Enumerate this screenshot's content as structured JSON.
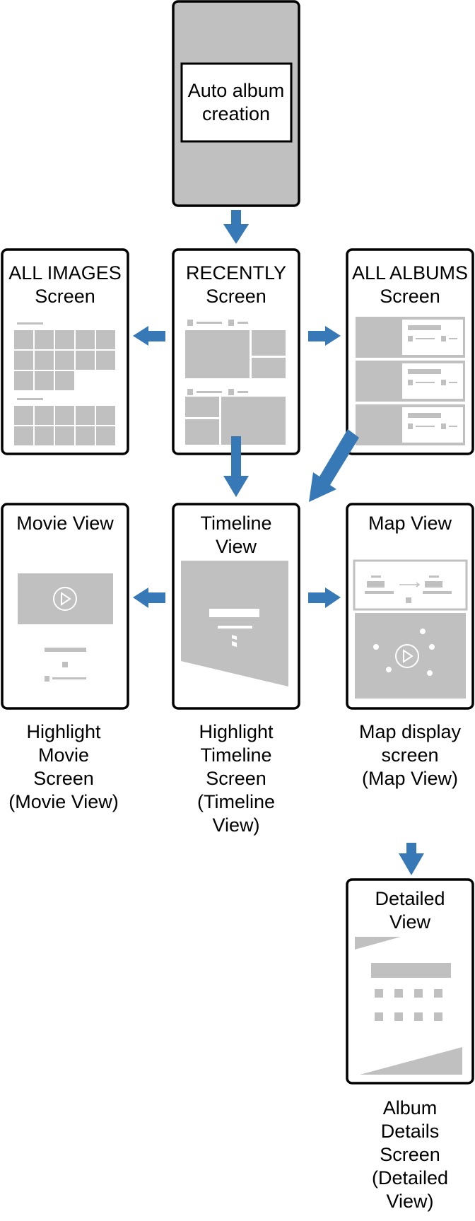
{
  "diagram": {
    "root": {
      "label_lines": [
        "Auto album",
        "creation"
      ]
    },
    "screens": {
      "all_images": {
        "title_lines": [
          "ALL IMAGES",
          "Screen"
        ]
      },
      "recently": {
        "title_lines": [
          "RECENTLY",
          "Screen"
        ]
      },
      "all_albums": {
        "title_lines": [
          "ALL ALBUMS",
          "Screen"
        ]
      },
      "movie_view": {
        "title_lines": [
          "Movie View"
        ],
        "caption_lines": [
          "Highlight",
          "Movie",
          "Screen",
          "(Movie View)"
        ]
      },
      "timeline_view": {
        "title_lines": [
          "Timeline",
          "View"
        ],
        "caption_lines": [
          "Highlight",
          "Timeline",
          "Screen",
          "(Timeline",
          "View)"
        ]
      },
      "map_view": {
        "title_lines": [
          "Map View"
        ],
        "caption_lines": [
          "Map display",
          "screen",
          "(Map View)"
        ]
      },
      "detailed_view": {
        "title_lines": [
          "Detailed",
          "View"
        ],
        "caption_lines": [
          "Album",
          "Details",
          "Screen",
          "(Detailed",
          "View)"
        ]
      }
    },
    "edges": [
      {
        "from": "Auto album creation",
        "to": "RECENTLY Screen"
      },
      {
        "from": "RECENTLY Screen",
        "to": "ALL IMAGES Screen"
      },
      {
        "from": "RECENTLY Screen",
        "to": "ALL ALBUMS Screen"
      },
      {
        "from": "RECENTLY Screen",
        "to": "Timeline View"
      },
      {
        "from": "ALL ALBUMS Screen",
        "to": "Timeline View"
      },
      {
        "from": "Timeline View",
        "to": "Movie View"
      },
      {
        "from": "Timeline View",
        "to": "Map View"
      },
      {
        "from": "Map View",
        "to": "Detailed View"
      }
    ],
    "colors": {
      "arrow": "#3778b6",
      "placeholder": "#c0c0c0",
      "frame_stroke": "#000000",
      "root_fill": "#c0c0c0"
    },
    "icons": {
      "play": "play-circle-icon"
    }
  }
}
